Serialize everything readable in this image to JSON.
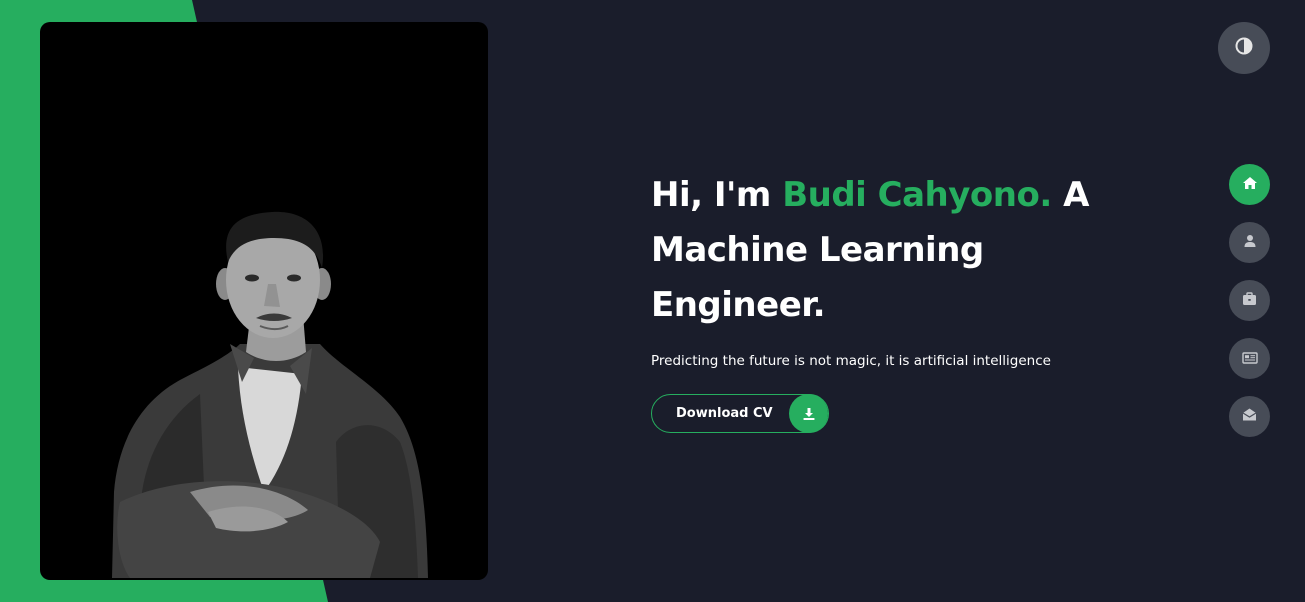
{
  "hero": {
    "greeting": "Hi, I'm",
    "name": "Budi Cahyono.",
    "role_line_1": "A",
    "role_line_2": "Machine Learning",
    "role_line_3": "Engineer.",
    "tagline": "Predicting the future is not magic, it is artificial intelligence"
  },
  "cv_button": {
    "label": "Download CV",
    "icon": "download-icon"
  },
  "theme_toggle": {
    "icon": "contrast-icon"
  },
  "nav": {
    "items": [
      {
        "name": "home",
        "icon": "home-icon",
        "active": true
      },
      {
        "name": "about",
        "icon": "user-icon",
        "active": false
      },
      {
        "name": "portfolio",
        "icon": "briefcase-icon",
        "active": false
      },
      {
        "name": "blog",
        "icon": "newspaper-icon",
        "active": false
      },
      {
        "name": "contact",
        "icon": "envelope-open-icon",
        "active": false
      }
    ]
  },
  "colors": {
    "accent": "#26ae5f",
    "background": "#1a1d2b",
    "button_gray": "#474c57"
  }
}
